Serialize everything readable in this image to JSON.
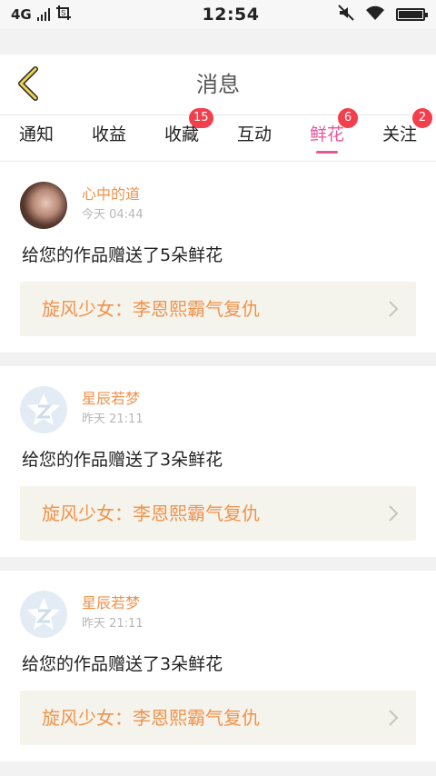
{
  "status": {
    "carrier": "4G",
    "time": "12:54"
  },
  "header": {
    "title": "消息"
  },
  "tabs": [
    {
      "label": "通知",
      "badge": ""
    },
    {
      "label": "收益",
      "badge": ""
    },
    {
      "label": "收藏",
      "badge": "15"
    },
    {
      "label": "互动",
      "badge": ""
    },
    {
      "label": "鲜花",
      "badge": "6",
      "active": true
    },
    {
      "label": "关注",
      "badge": "2"
    }
  ],
  "messages": [
    {
      "name": "心中的道",
      "time": "今天 04:44",
      "text": "给您的作品赠送了5朵鲜花",
      "work": "旋风少女：李恩熙霸气复仇",
      "avatar": "photo"
    },
    {
      "name": "星辰若梦",
      "time": "昨天 21:11",
      "text": "给您的作品赠送了3朵鲜花",
      "work": "旋风少女：李恩熙霸气复仇",
      "avatar": "default"
    },
    {
      "name": "星辰若梦",
      "time": "昨天 21:11",
      "text": "给您的作品赠送了3朵鲜花",
      "work": "旋风少女：李恩熙霸气复仇",
      "avatar": "default"
    }
  ],
  "colors": {
    "accent": "#e8569a",
    "name": "#f0924c",
    "badge": "#f33e4c"
  }
}
